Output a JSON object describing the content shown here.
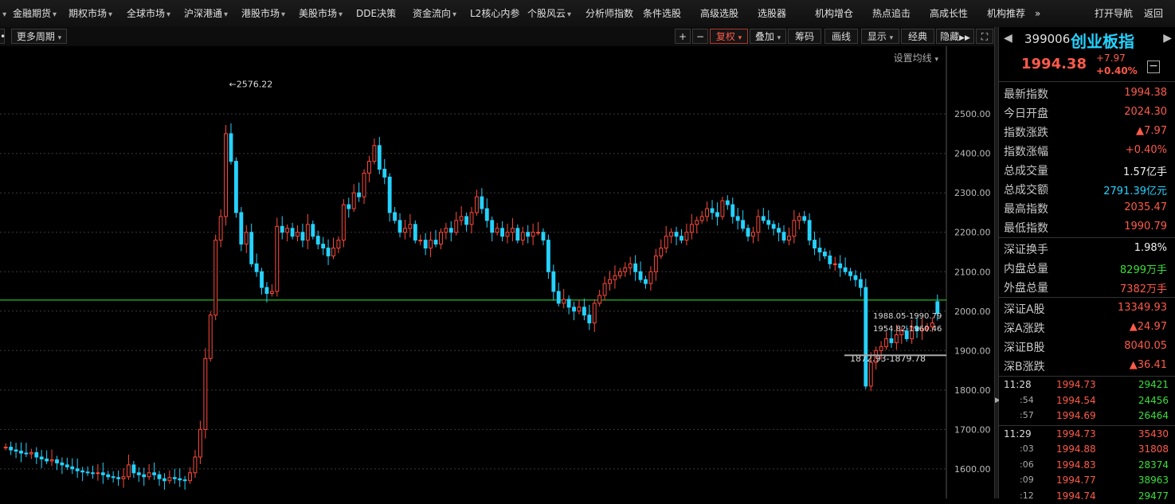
{
  "top_menu": [
    {
      "label": "•",
      "dropdown": true
    },
    {
      "label": "金融期货",
      "dropdown": true
    },
    {
      "label": "期权市场",
      "dropdown": true
    },
    {
      "label": "全球市场",
      "dropdown": true
    },
    {
      "label": "沪深港通",
      "dropdown": true
    },
    {
      "label": "港股市场",
      "dropdown": true
    },
    {
      "label": "美股市场",
      "dropdown": true
    },
    {
      "label": "DDE决策",
      "dropdown": false
    },
    {
      "label": "资金流向",
      "dropdown": true
    },
    {
      "label": "L2核心内参",
      "dropdown": false
    },
    {
      "label": "个股风云",
      "dropdown": true
    },
    {
      "label": "分析师指数",
      "dropdown": false
    },
    {
      "label": "条件选股",
      "dropdown": false
    },
    {
      "label": "高级选股",
      "dropdown": false
    },
    {
      "label": "选股器",
      "dropdown": false
    },
    {
      "label": "机构增仓",
      "dropdown": false
    },
    {
      "label": "热点追击",
      "dropdown": false
    },
    {
      "label": "高成长性",
      "dropdown": false
    },
    {
      "label": "机构推荐",
      "dropdown": false
    },
    {
      "label": "»",
      "dropdown": false
    },
    {
      "label": "打开导航",
      "dropdown": false
    },
    {
      "label": "返回",
      "dropdown": false
    }
  ],
  "toolbar": {
    "period_label": "更多周期",
    "zoom_in": "+",
    "zoom_out": "−",
    "fuquan": "复权",
    "overlay": "叠加",
    "chip": "筹码",
    "draw": "画线",
    "display": "显示",
    "classic": "经典",
    "hide": "隐藏",
    "fullscreen": "⛶"
  },
  "chart": {
    "ma_setting": "设置均线",
    "peak_label": "2576.22",
    "low_label": "1872.93-1879.78",
    "annot_1": "1988.05-1990.79",
    "annot_2": "1954.82-1960.46",
    "colors": {
      "up": "#ff4a3a",
      "down": "#25d2ff",
      "ref": "#2ee82e",
      "grid": "#3a3a3a"
    }
  },
  "chart_data": {
    "type": "candlestick",
    "y_ticks": [
      2500,
      2400,
      2300,
      2200,
      2100,
      2000,
      1900,
      1800,
      1700,
      1600
    ],
    "ylim": [
      1525,
      2672
    ],
    "reference_line": 2028,
    "peak": 2576.22,
    "low_range": [
      1872.93,
      1879.78
    ]
  },
  "sidebar": {
    "code": "399006",
    "name": "创业板指",
    "price": "1994.38",
    "change": "+7.97",
    "change_pct": "+0.40%",
    "stats": [
      {
        "label": "最新指数",
        "value": "1994.38",
        "color": "red"
      },
      {
        "label": "今日开盘",
        "value": "2024.30",
        "color": "red"
      },
      {
        "label": "指数涨跌",
        "value": "▲7.97",
        "color": "red"
      },
      {
        "label": "指数涨幅",
        "value": "+0.40%",
        "color": "red"
      },
      {
        "label": "总成交量",
        "value": "1.57亿手",
        "color": "white"
      },
      {
        "label": "总成交额",
        "value": "2791.39亿元",
        "color": "cyan"
      },
      {
        "label": "最高指数",
        "value": "2035.47",
        "color": "red"
      },
      {
        "label": "最低指数",
        "value": "1990.79",
        "color": "red"
      }
    ],
    "stats2": [
      {
        "label": "深证换手",
        "value": "1.98%",
        "color": "white"
      },
      {
        "label": "内盘总量",
        "value": "8299万手",
        "color": "green"
      },
      {
        "label": "外盘总量",
        "value": "7382万手",
        "color": "red"
      }
    ],
    "stats3": [
      {
        "label": "深证A股",
        "value": "13349.93",
        "color": "red"
      },
      {
        "label": "深A涨跌",
        "value": "▲24.97",
        "color": "red"
      },
      {
        "label": "深证B股",
        "value": "8040.05",
        "color": "red"
      },
      {
        "label": "深B涨跌",
        "value": "▲36.41",
        "color": "red"
      }
    ],
    "ticks1": [
      {
        "time": "11:28",
        "price": "1994.73",
        "vol": "29421",
        "vc": "green"
      },
      {
        "time": ":54",
        "price": "1994.54",
        "vol": "24456",
        "vc": "green"
      },
      {
        "time": ":57",
        "price": "1994.69",
        "vol": "26464",
        "vc": "green"
      }
    ],
    "ticks2": [
      {
        "time": "11:29",
        "price": "1994.73",
        "vol": "35430",
        "vc": "red"
      },
      {
        "time": ":03",
        "price": "1994.88",
        "vol": "31808",
        "vc": "red"
      },
      {
        "time": ":06",
        "price": "1994.83",
        "vol": "28374",
        "vc": "green"
      },
      {
        "time": ":09",
        "price": "1994.77",
        "vol": "38963",
        "vc": "green"
      },
      {
        "time": ":12",
        "price": "1994.74",
        "vol": "29477",
        "vc": "green"
      }
    ]
  }
}
